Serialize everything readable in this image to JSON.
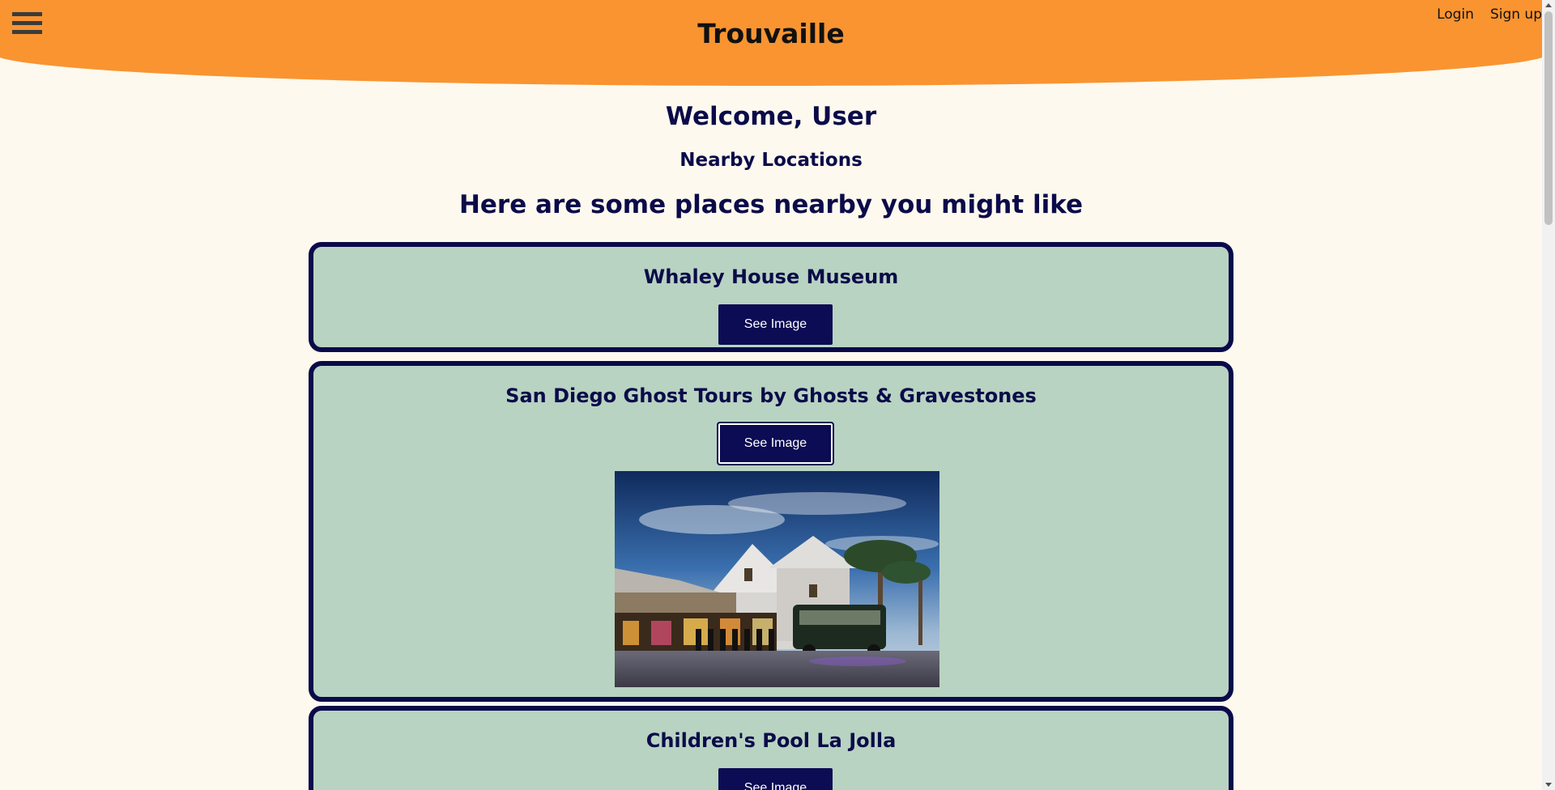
{
  "header": {
    "title": "Trouvaille",
    "login_label": "Login",
    "signup_label": "Sign up",
    "menu_icon": "hamburger-menu-icon"
  },
  "main": {
    "welcome": "Welcome, User",
    "section_title": "Nearby Locations",
    "intro": "Here are some places nearby you might like"
  },
  "places": [
    {
      "name": "Whaley House Museum",
      "button_label": "See Image",
      "image_shown": false
    },
    {
      "name": "San Diego Ghost Tours by Ghosts & Gravestones",
      "button_label": "See Image",
      "image_shown": true
    },
    {
      "name": "Children's Pool La Jolla",
      "button_label": "See Image",
      "image_shown": false
    }
  ],
  "colors": {
    "header_bg": "#f99431",
    "page_bg": "#fdf9ee",
    "card_bg": "#b8d3c1",
    "card_border": "#0a0a4a",
    "button_bg": "#0c0c54",
    "text": "#0b0b4a"
  }
}
